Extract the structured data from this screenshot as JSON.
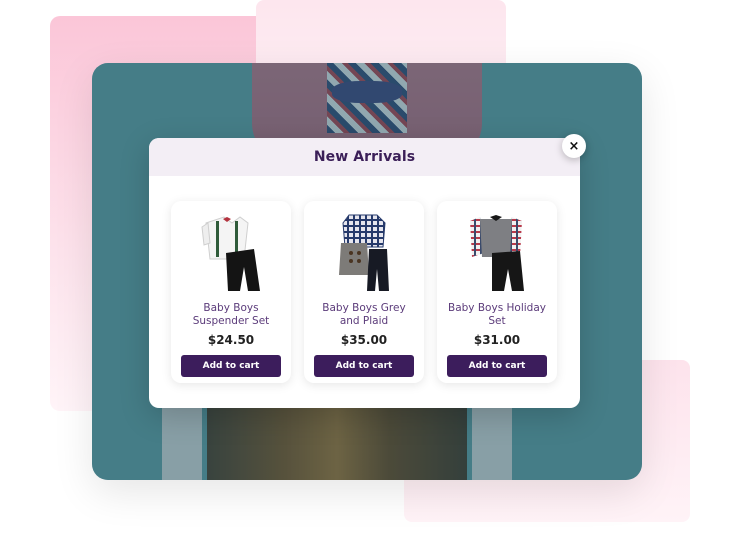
{
  "modal": {
    "title": "New Arrivals",
    "close_label": "×"
  },
  "products": [
    {
      "name": "Baby Boys Suspender Set",
      "price": "$24.50",
      "button_label": "Add to cart",
      "image": "suspender-set-outfit"
    },
    {
      "name": "Baby Boys Grey and Plaid",
      "price": "$35.00",
      "button_label": "Add to cart",
      "image": "grey-plaid-outfit"
    },
    {
      "name": "Baby Boys Holiday Set",
      "price": "$31.00",
      "button_label": "Add to cart",
      "image": "holiday-set-outfit"
    }
  ],
  "colors": {
    "accent": "#3c1d5c",
    "header_bg": "#f3eef5",
    "photo_bg": "#5e9aa5",
    "pink": "#fbc6d8"
  }
}
